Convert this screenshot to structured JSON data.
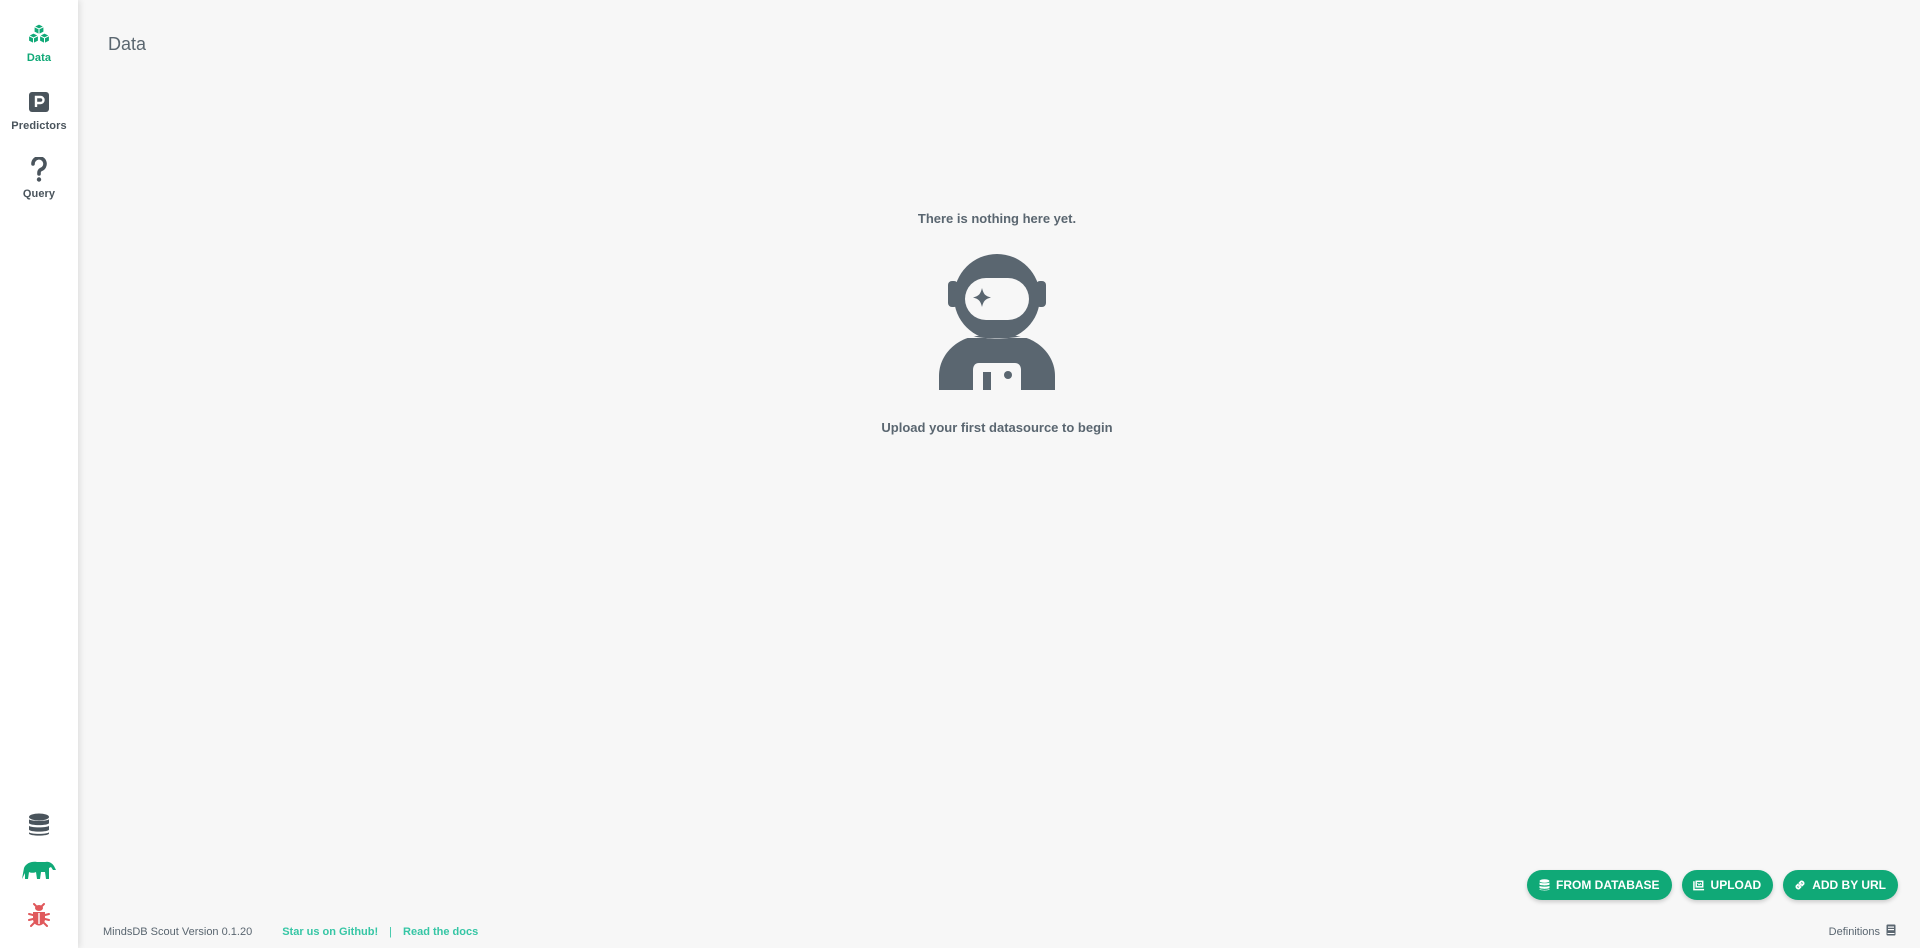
{
  "sidebar": {
    "items": [
      {
        "label": "Data",
        "icon": "cubes-icon",
        "active": true
      },
      {
        "label": "Predictors",
        "icon": "predictor-icon",
        "active": false
      },
      {
        "label": "Query",
        "icon": "question-icon",
        "active": false
      }
    ],
    "bottom_icons": [
      "database-icon",
      "mindsdb-logo-icon",
      "bug-icon"
    ]
  },
  "header": {
    "title": "Data"
  },
  "empty_state": {
    "title": "There is nothing here yet.",
    "subtitle": "Upload your first datasource to begin",
    "illustration": "astronaut-icon"
  },
  "actions": {
    "from_database": "FROM DATABASE",
    "upload": "UPLOAD",
    "add_by_url": "ADD BY URL"
  },
  "footer": {
    "version": "MindsDB Scout Version 0.1.20",
    "github": "Star us on Github!",
    "separator": "|",
    "docs": "Read the docs",
    "definitions": "Definitions"
  },
  "colors": {
    "accent": "#10a977",
    "link": "#36c6a5",
    "icon_dark": "#5a6670",
    "bug": "#e0585b"
  }
}
